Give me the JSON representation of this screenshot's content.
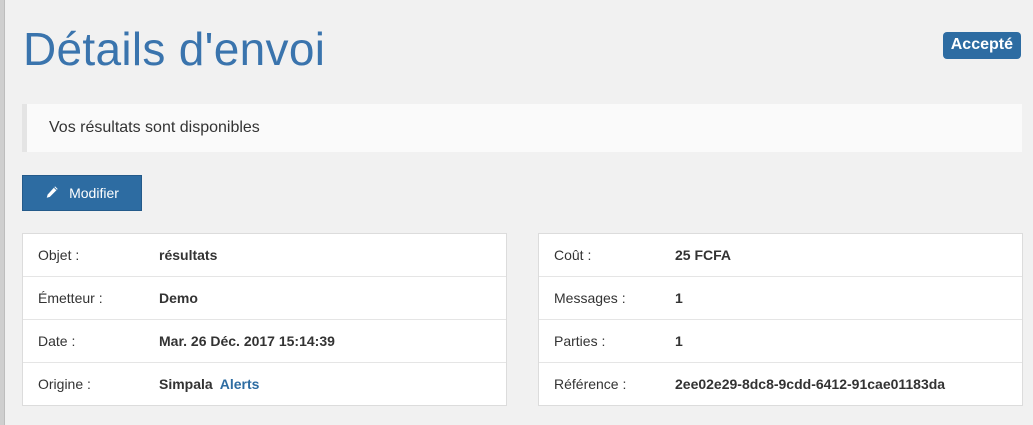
{
  "header": {
    "title": "Détails d'envoi",
    "status_badge": "Accepté"
  },
  "notice": {
    "text": "Vos résultats sont disponibles"
  },
  "toolbar": {
    "edit_label": "Modifier",
    "edit_icon": "pencil-icon"
  },
  "details_left": {
    "rows": [
      {
        "label": "Objet :",
        "value": "résultats"
      },
      {
        "label": "Émetteur :",
        "value": "Demo"
      },
      {
        "label": "Date :",
        "value": "Mar. 26 Déc. 2017 15:14:39"
      },
      {
        "label": "Origine :",
        "value": "Simpala",
        "link": "Alerts"
      }
    ]
  },
  "details_right": {
    "rows": [
      {
        "label": "Coût :",
        "value": "25 FCFA"
      },
      {
        "label": "Messages :",
        "value": "1"
      },
      {
        "label": "Parties :",
        "value": "1"
      },
      {
        "label": "Référence :",
        "value": "2ee02e29-8dc8-9cdd-6412-91cae01183da"
      }
    ]
  },
  "colors": {
    "accent": "#2d6ca2",
    "title": "#3a74ad",
    "background": "#f1f1f1"
  }
}
